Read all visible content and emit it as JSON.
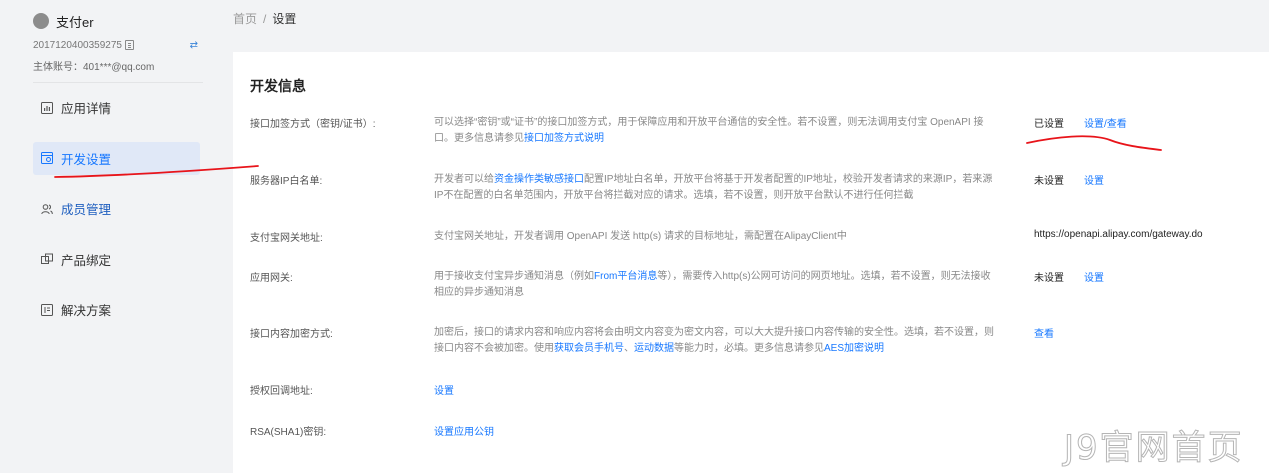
{
  "sidebar": {
    "app_name": "支付er",
    "app_id": "2017120400359275",
    "owner_label": "主体账号：",
    "owner_value": "401***@qq.com",
    "items": [
      {
        "label": "应用详情",
        "icon": "app-detail-icon",
        "active": false
      },
      {
        "label": "开发设置",
        "icon": "dev-settings-icon",
        "active": true
      },
      {
        "label": "成员管理",
        "icon": "members-icon",
        "active": false
      },
      {
        "label": "产品绑定",
        "icon": "product-bind-icon",
        "active": false
      },
      {
        "label": "解决方案",
        "icon": "solution-icon",
        "active": false
      }
    ]
  },
  "breadcrumb": {
    "home": "首页",
    "sep": "/",
    "current": "设置"
  },
  "card": {
    "title": "开发信息",
    "rows": {
      "sign": {
        "label": "接口加签方式（密钥/证书）:",
        "desc1": "可以选择“密钥”或“证书”的接口加签方式，用于保障应用和开放平台通信的安全性。若不设置，则无法调用支付宝 OpenAPI 接口。更多信息请参见",
        "link": "接口加签方式说明",
        "status": "已设置",
        "action": "设置/查看"
      },
      "ip": {
        "label": "服务器IP白名单:",
        "desc_pre": "开发者可以给",
        "link": "资金操作类敏感接口",
        "desc_post": "配置IP地址白名单，开放平台将基于开发者配置的IP地址，校验开发者请求的来源IP，若来源IP不在配置的白名单范围内，开放平台将拦截对应的请求。选填，若不设置，则开放平台默认不进行任何拦截",
        "status": "未设置",
        "action": "设置"
      },
      "gateway": {
        "label": "支付宝网关地址:",
        "desc": "支付宝网关地址，开发者调用 OpenAPI 发送 http(s) 请求的目标地址，需配置在AlipayClient中",
        "value": "https://openapi.alipay.com/gateway.do"
      },
      "appgw": {
        "label": "应用网关:",
        "desc_pre": "用于接收支付宝异步通知消息（例如",
        "link": "From平台消息",
        "desc_post": "等），需要传入http(s)公网可访问的网页地址。选填，若不设置，则无法接收相应的异步通知消息",
        "status": "未设置",
        "action": "设置"
      },
      "encrypt": {
        "label": "接口内容加密方式:",
        "desc_pre": "加密后，接口的请求内容和响应内容将会由明文内容变为密文内容，可以大大提升接口内容传输的安全性。选填，若不设置，则接口内容不会被加密。使用",
        "link1": "获取会员手机号",
        "mid": "、",
        "link2": "运动数据",
        "desc_mid": "等能力时，必填。更多信息请参见",
        "link3": "AES加密说明",
        "action": "查看"
      },
      "callback": {
        "label": "授权回调地址:",
        "action": "设置"
      },
      "rsa": {
        "label": "RSA(SHA1)密钥:",
        "action": "设置应用公钥"
      }
    }
  },
  "watermark": "J9官网首页",
  "colors": {
    "accent": "#1677ff",
    "annotation": "#e8141a"
  }
}
